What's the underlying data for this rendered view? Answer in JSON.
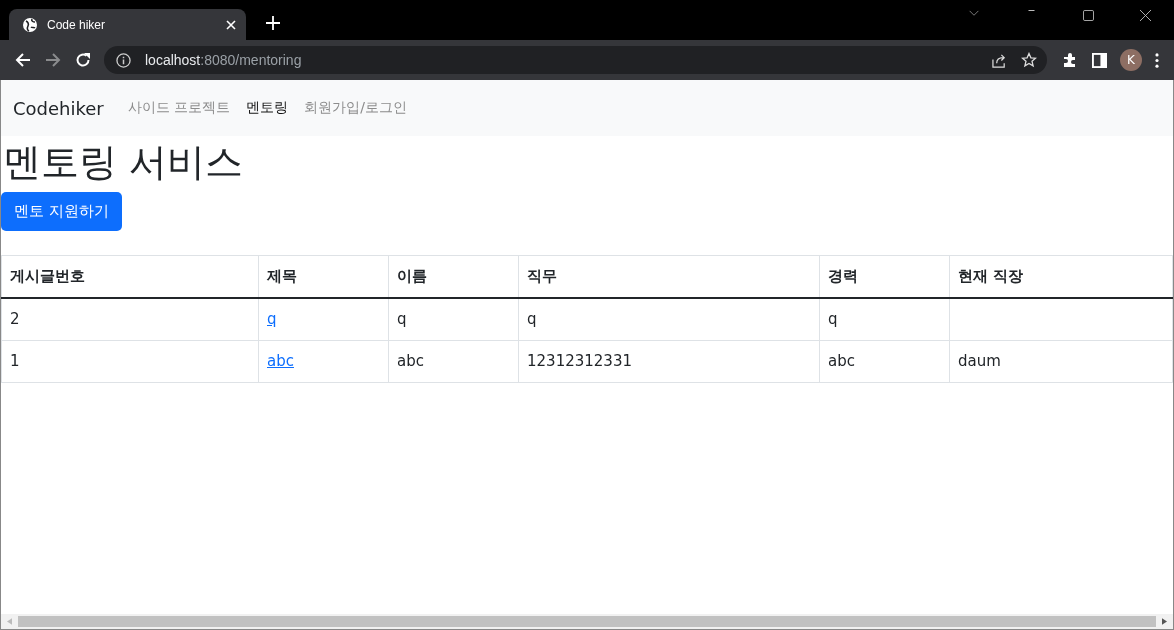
{
  "browser": {
    "tab_title": "Code hiker",
    "address_host": "localhost",
    "address_path": ":8080/mentoring",
    "profile_initial": "K"
  },
  "navbar": {
    "brand": "Codehiker",
    "items": [
      {
        "label": "사이드 프로젝트",
        "selected": false
      },
      {
        "label": "멘토링",
        "selected": true
      },
      {
        "label": "회원가입/로그인",
        "selected": false
      }
    ]
  },
  "heading": "멘토링 서비스",
  "apply_button": "멘토 지원하기",
  "table": {
    "columns": [
      {
        "label": "게시글번호",
        "kind": "text"
      },
      {
        "label": "제목",
        "kind": "link"
      },
      {
        "label": "이름",
        "kind": "text"
      },
      {
        "label": "직무",
        "kind": "text"
      },
      {
        "label": "경력",
        "kind": "text"
      },
      {
        "label": "현재 직장",
        "kind": "text"
      }
    ],
    "rows": [
      {
        "cells": [
          "2",
          "q",
          "q",
          "q",
          "q",
          null
        ]
      },
      {
        "cells": [
          "1",
          "abc",
          "abc",
          "12312312331",
          "abc",
          "daum"
        ]
      }
    ]
  }
}
